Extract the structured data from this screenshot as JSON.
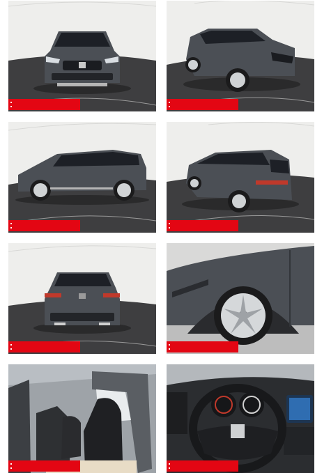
{
  "gallery": {
    "photos": [
      {
        "view": "front"
      },
      {
        "view": "front-three-quarter"
      },
      {
        "view": "side"
      },
      {
        "view": "rear-three-quarter"
      },
      {
        "view": "rear"
      },
      {
        "view": "wheel-detail"
      },
      {
        "view": "interior-seats"
      },
      {
        "view": "steering-wheel"
      }
    ],
    "colors": {
      "badge": "#e30613",
      "car_body": "#4b4f55",
      "turntable": "#3e3e40",
      "studio_wall": "#eeeeec",
      "glass": "#1d2026"
    }
  }
}
